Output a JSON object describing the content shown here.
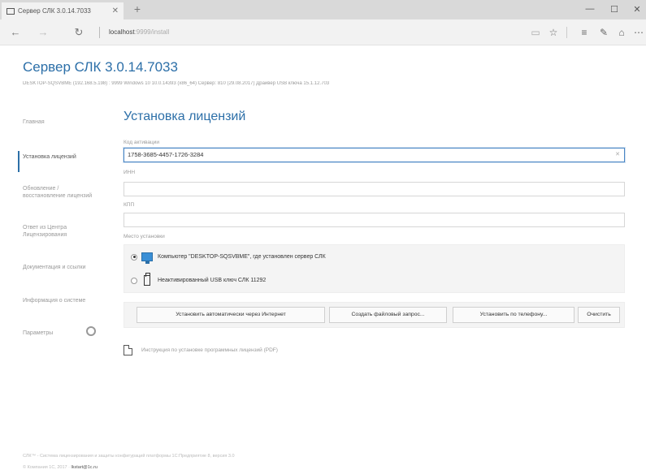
{
  "browser": {
    "tab_title": "Сервер СЛК 3.0.14.7033",
    "tab_close": "✕",
    "new_tab": "+",
    "url_host": "localhost",
    "url_path": ":9999/install",
    "window_minimize": "—",
    "window_maximize": "☐",
    "window_close": "✕"
  },
  "header": {
    "title": "Сервер СЛК 3.0.14.7033",
    "subtitle": "DESKTOP-SQSVBME (192.168.5.198) : 9999   Windows 10 10.0.14393 (x86_64)   Сервер: 810 (29.08.2017)   Драйвер USB ключа 15.1.12.703"
  },
  "sidebar": {
    "items": [
      {
        "label": "Главная"
      },
      {
        "label": "Установка лицензий"
      },
      {
        "label": "Обновление / восстановление лицензий"
      },
      {
        "label": "Ответ из Центра Лицензирования"
      },
      {
        "label": "Документация и ссылки"
      },
      {
        "label": "Информация о системе"
      },
      {
        "label": "Параметры"
      }
    ]
  },
  "main": {
    "title": "Установка лицензий",
    "activation_code_label": "Код активации",
    "activation_code_value": "1758-3685-4457-1726-3284",
    "inn_label": "ИНН",
    "kpp_label": "КПП",
    "install_place_label": "Место установки",
    "options": [
      {
        "label": "Компьютер \"DESKTOP-SQSVBME\", где установлен сервер СЛК",
        "checked": true
      },
      {
        "label": "Неактивированный USB ключ СЛК 11292",
        "checked": false
      }
    ],
    "buttons": {
      "install_online": "Установить автоматически через Интернет",
      "create_request": "Создать файловый запрос...",
      "install_phone": "Установить по телефону...",
      "clear": "Очистить"
    },
    "pdf_link": "Инструкция по установке программных лицензий (PDF)"
  },
  "footer": {
    "line1": "СЛК™ - Система лицензирования и защиты конфигураций платформы 1С:Предприятие 8, версия 3.0",
    "line2_prefix": "© Компания 1С, 2017 · ",
    "email": "lkstart@1c.ru"
  },
  "colors": {
    "accent": "#2c6fa8",
    "muted_text": "#999999",
    "panel_bg": "#f4f4f4",
    "focus_border": "#4a86c5"
  }
}
